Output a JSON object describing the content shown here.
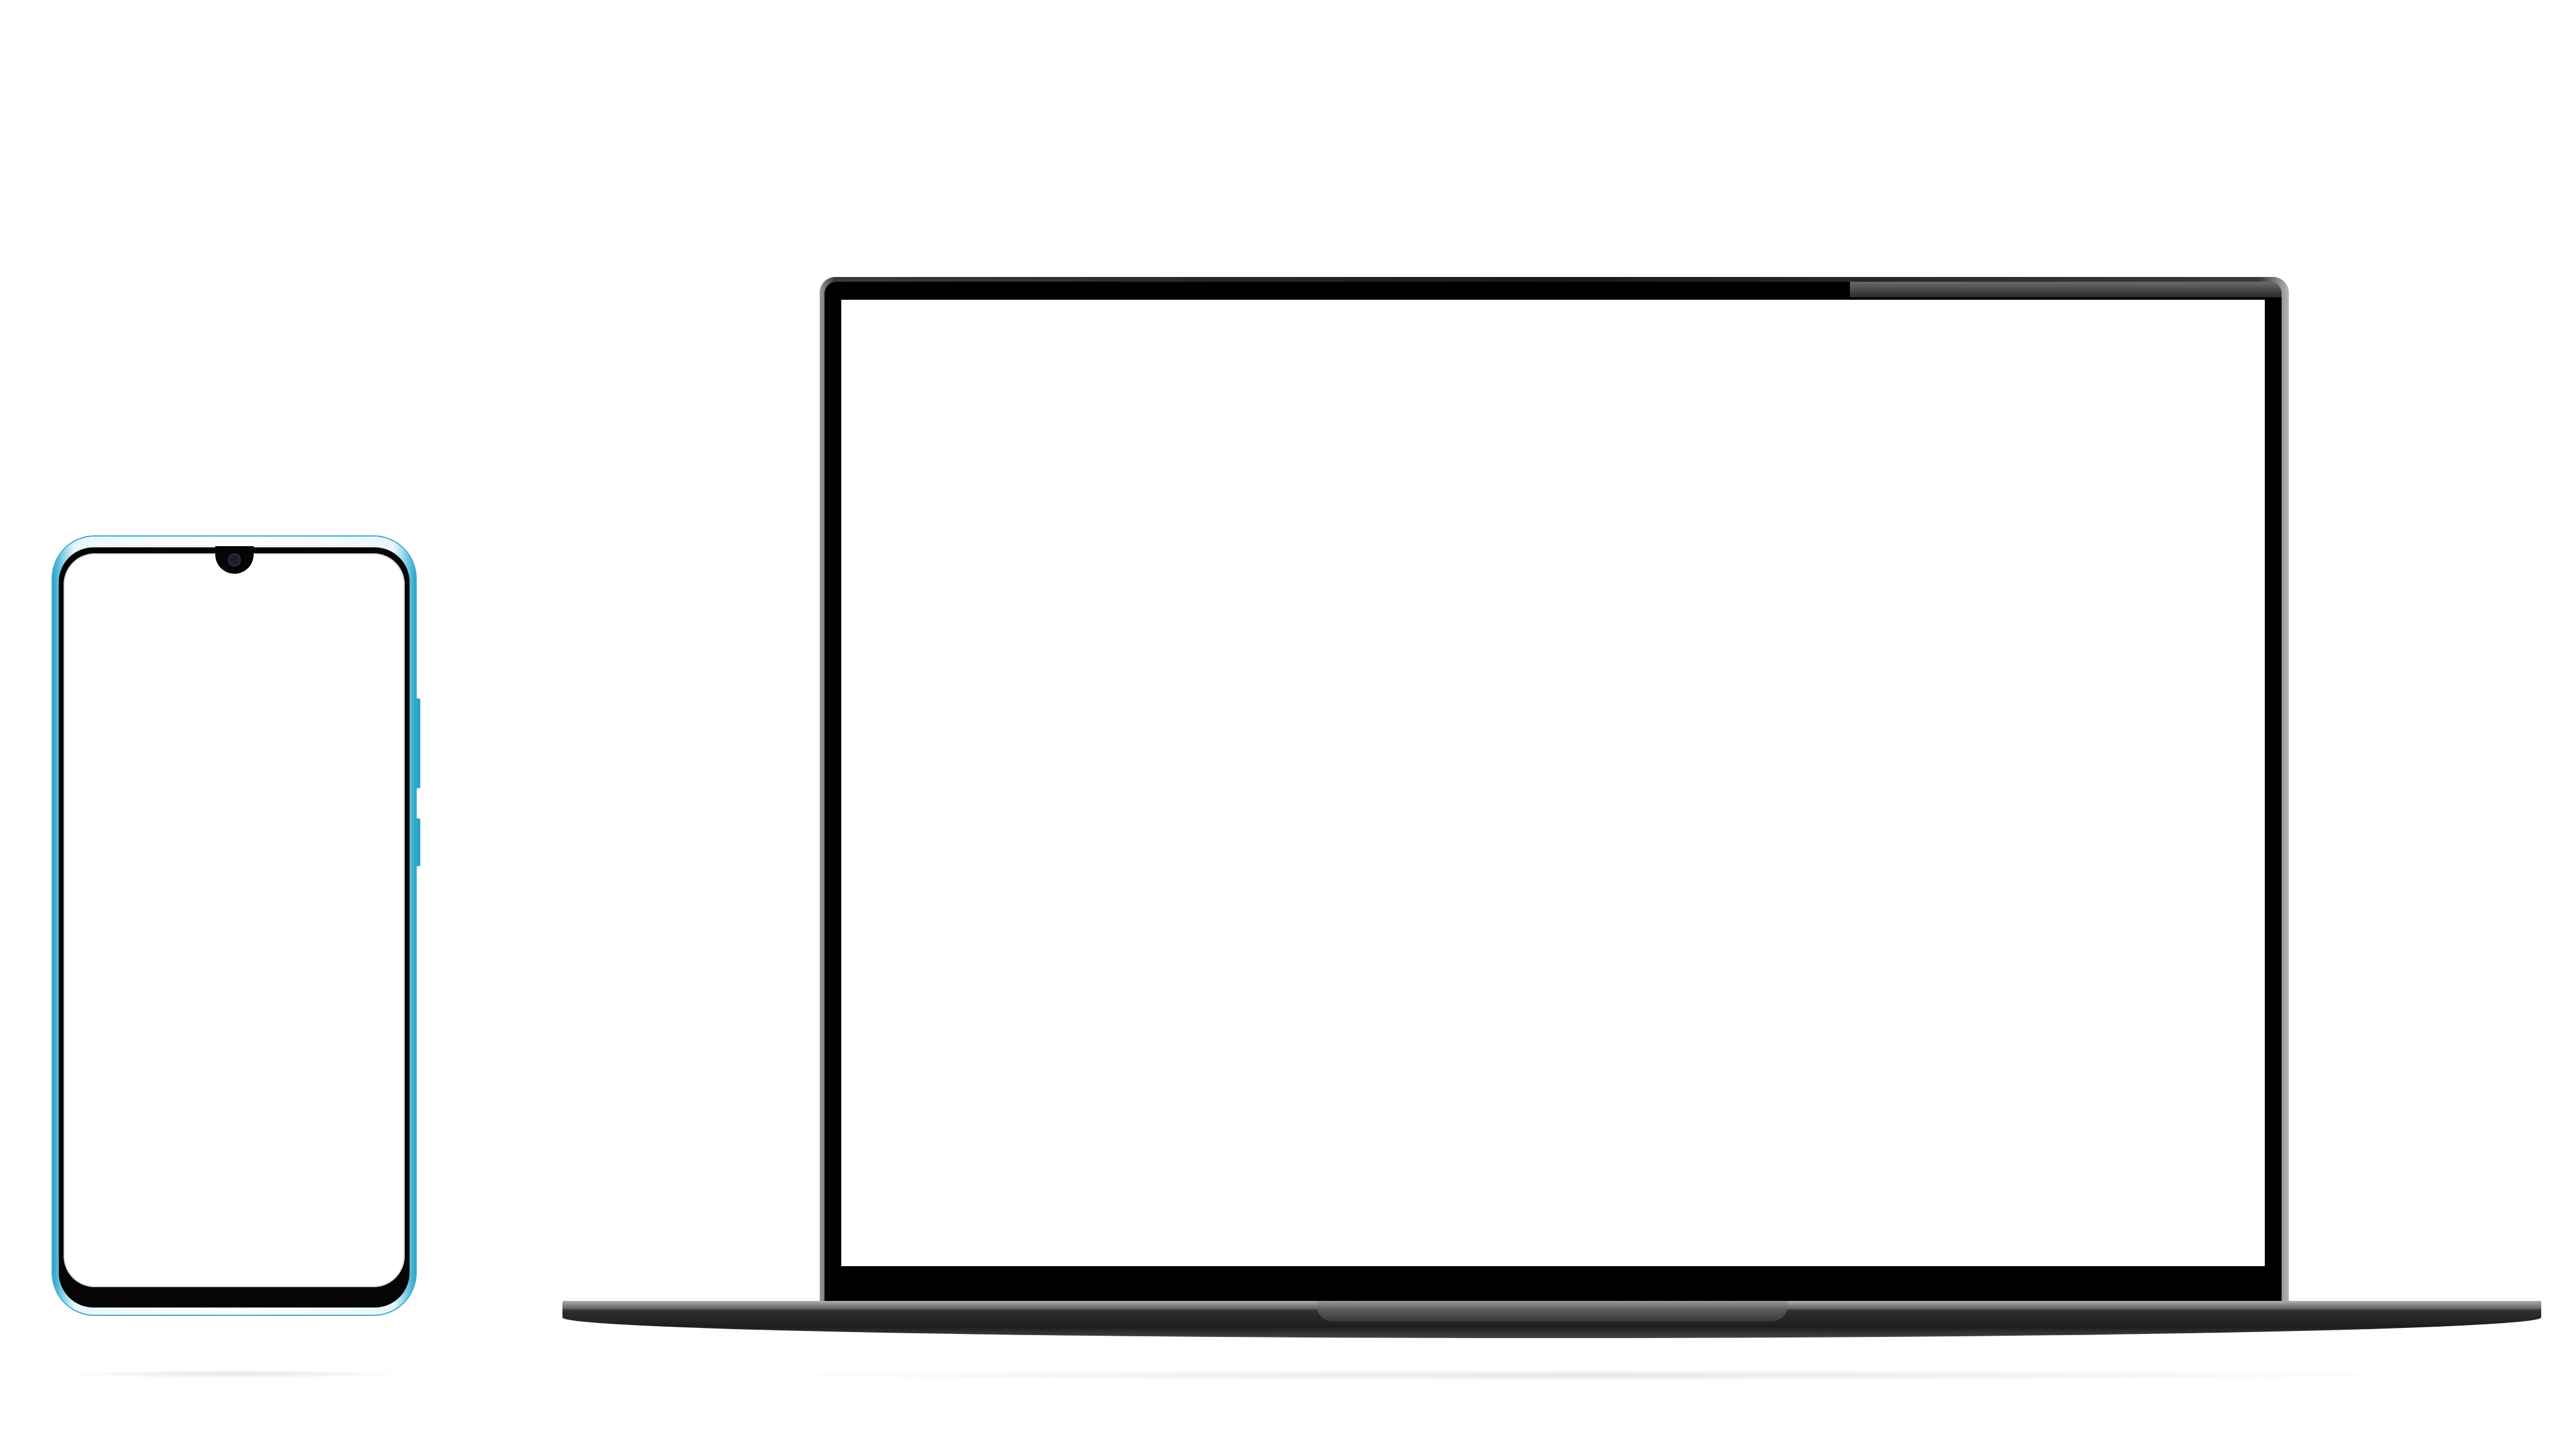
{
  "devices": {
    "phone": {
      "icons": [
        "camera-icon"
      ],
      "accent_color": "#2aa3c9",
      "screen_color": "#ffffff"
    },
    "laptop": {
      "bezel_color": "#000000",
      "screen_color": "#ffffff"
    }
  },
  "background_color": "#ffffff"
}
